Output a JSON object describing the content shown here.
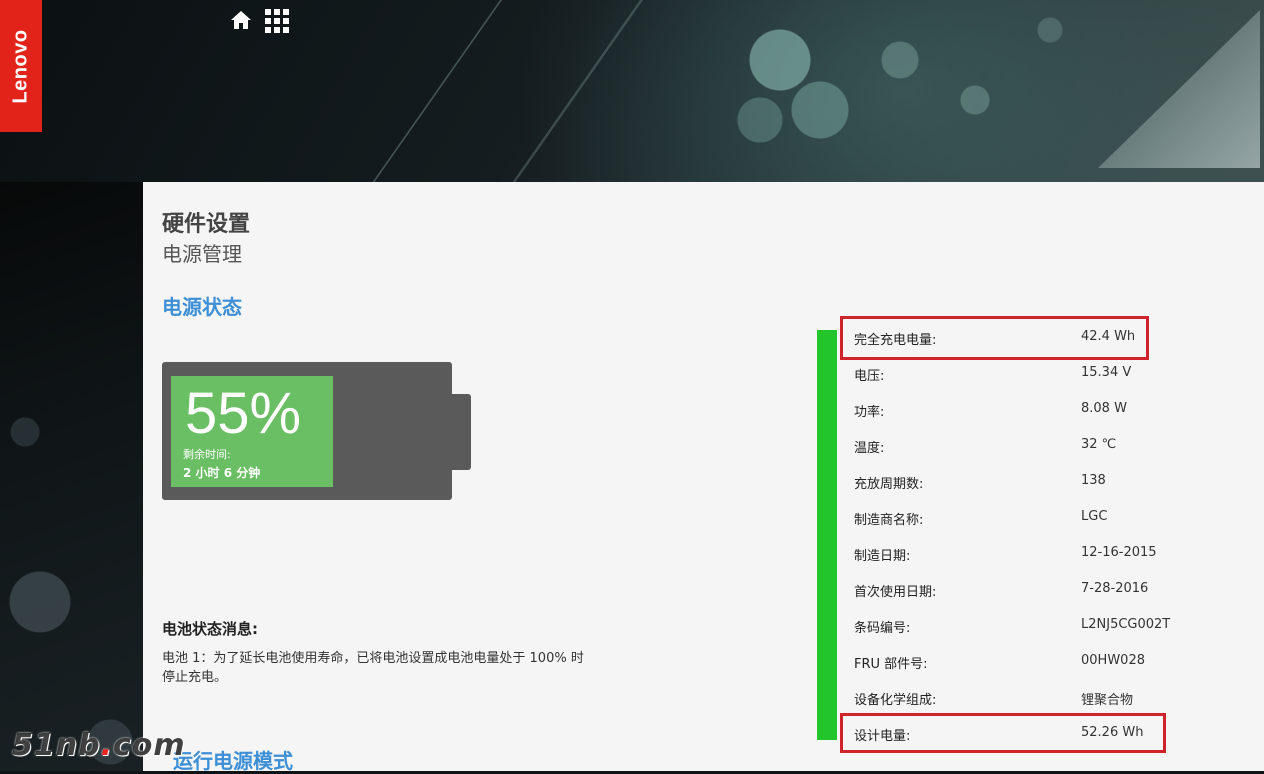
{
  "brand": {
    "name": "Lenovo",
    "color": "#e2231a"
  },
  "header": {
    "home_icon": "home-icon",
    "apps_icon": "apps-grid-icon"
  },
  "page": {
    "title": "硬件设置",
    "subtitle": "电源管理"
  },
  "section": {
    "title": "电源状态"
  },
  "battery": {
    "percent_label": "55%",
    "percent_value": 0.55,
    "remaining_label": "剩余时间:",
    "remaining_value": "2 小时 6 分钟"
  },
  "message": {
    "title": "电池状态消息:",
    "body": "电池 1：为了延长电池使用寿命，已将电池设置成电池电量处于 100% 时停止充电。"
  },
  "next_section": {
    "title": "运行电源模式"
  },
  "properties": [
    {
      "label": "完全充电电量:",
      "value": "42.4 Wh"
    },
    {
      "label": "电压:",
      "value": "15.34 V"
    },
    {
      "label": "功率:",
      "value": "8.08 W"
    },
    {
      "label": "温度:",
      "value": "32 ℃"
    },
    {
      "label": "充放周期数:",
      "value": "138"
    },
    {
      "label": "制造商名称:",
      "value": "LGC"
    },
    {
      "label": "制造日期:",
      "value": "12-16-2015"
    },
    {
      "label": "首次使用日期:",
      "value": "7-28-2016"
    },
    {
      "label": "条码编号:",
      "value": "L2NJ5CG002T"
    },
    {
      "label": "FRU 部件号:",
      "value": "00HW028"
    },
    {
      "label": "设备化学组成:",
      "value": "锂聚合物"
    },
    {
      "label": "设计电量:",
      "value": "52.26 Wh"
    }
  ],
  "watermark": {
    "prefix": "51nb",
    "dot": ".",
    "suffix": "com"
  },
  "colors": {
    "accent": "#3d8fd6",
    "battery_fill": "#6abf64",
    "status_bar": "#22c62a",
    "highlight": "#d0222b"
  }
}
